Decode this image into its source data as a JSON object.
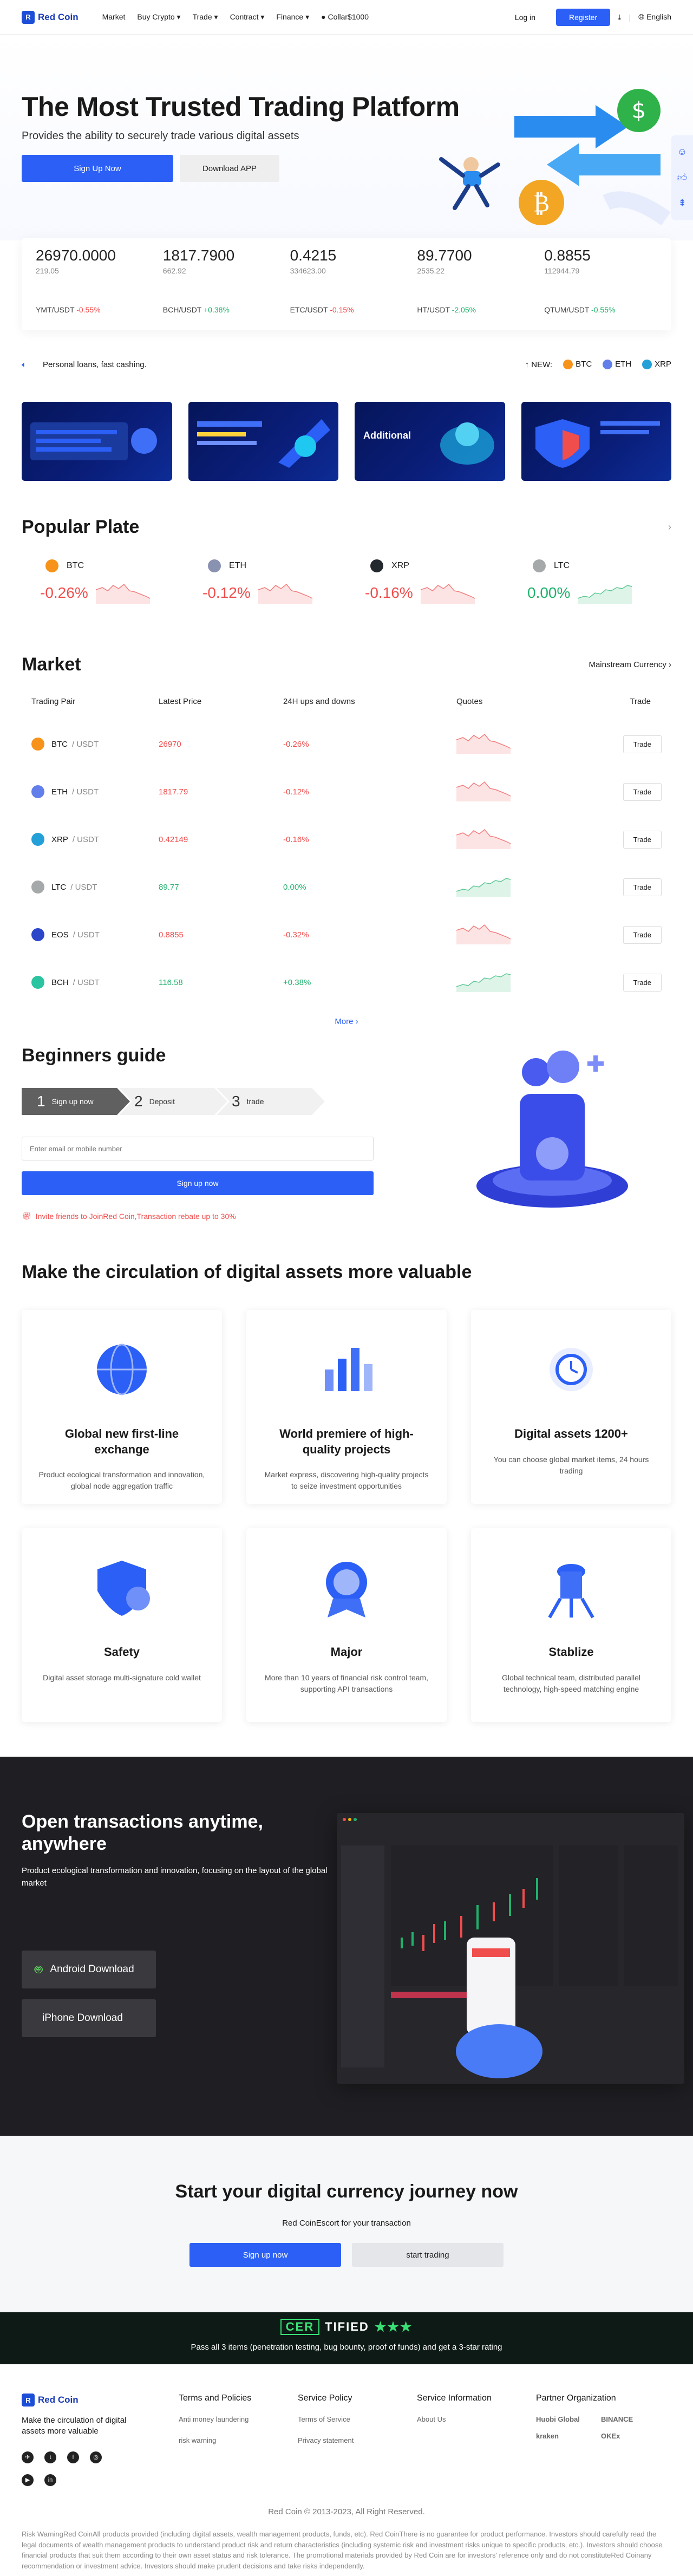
{
  "header": {
    "brand": "Red Coin",
    "nav": [
      "Market",
      "Buy Crypto ▾",
      "Trade ▾",
      "Contract ▾",
      "Finance ▾"
    ],
    "currency": "Collar$1000",
    "login": "Log in",
    "register": "Register",
    "language": "English"
  },
  "hero": {
    "title": "The Most Trusted Trading Platform",
    "subtitle": "Provides the ability to securely trade various digital assets",
    "signup": "Sign Up Now",
    "download": "Download APP"
  },
  "ticker": [
    {
      "price": "26970.0000",
      "vol": "219.05",
      "pair": "YMT/USDT",
      "chg": "-0.55%",
      "dir": "dn"
    },
    {
      "price": "1817.7900",
      "vol": "662.92",
      "pair": "BCH/USDT",
      "chg": "+0.38%",
      "dir": "up"
    },
    {
      "price": "0.4215",
      "vol": "334623.00",
      "pair": "ETC/USDT",
      "chg": "-0.15%",
      "dir": "dn"
    },
    {
      "price": "89.7700",
      "vol": "2535.22",
      "pair": "HT/USDT",
      "chg": "-2.05%",
      "dir": "up"
    },
    {
      "price": "0.8855",
      "vol": "112944.79",
      "pair": "QTUM/USDT",
      "chg": "-0.55%",
      "dir": "up"
    }
  ],
  "notice": {
    "message": "Personal loans, fast cashing.",
    "new_label": "NEW:",
    "coins": [
      "BTC",
      "ETH",
      "XRP"
    ]
  },
  "banners": [
    {
      "title": ""
    },
    {
      "title": ""
    },
    {
      "title": "Additional"
    },
    {
      "title": ""
    }
  ],
  "popular": {
    "title": "Popular Plate",
    "items": [
      {
        "name": "BTC",
        "chg": "-0.26%",
        "dir": "dn",
        "color": "#f7931a"
      },
      {
        "name": "ETH",
        "chg": "-0.12%",
        "dir": "dn",
        "color": "#8a92b2"
      },
      {
        "name": "XRP",
        "chg": "-0.16%",
        "dir": "dn",
        "color": "#23292f"
      },
      {
        "name": "LTC",
        "chg": "0.00%",
        "dir": "up",
        "color": "#a6a9aa"
      }
    ]
  },
  "market": {
    "title": "Market",
    "link": "Mainstream Currency",
    "headers": [
      "Trading Pair",
      "Latest Price",
      "24H ups and downs",
      "Quotes",
      "Trade"
    ],
    "rows": [
      {
        "base": "BTC",
        "quote": "/ USDT",
        "price": "26970",
        "chg": "-0.26%",
        "dir": "dn",
        "color": "#f7931a"
      },
      {
        "base": "ETH",
        "quote": "/ USDT",
        "price": "1817.79",
        "chg": "-0.12%",
        "dir": "dn",
        "color": "#627eea"
      },
      {
        "base": "XRP",
        "quote": "/ USDT",
        "price": "0.42149",
        "chg": "-0.16%",
        "dir": "dn",
        "color": "#23a0d8"
      },
      {
        "base": "LTC",
        "quote": "/ USDT",
        "price": "89.77",
        "chg": "0.00%",
        "dir": "up",
        "color": "#a6a9aa"
      },
      {
        "base": "EOS",
        "quote": "/ USDT",
        "price": "0.8855",
        "chg": "-0.32%",
        "dir": "dn",
        "color": "#2b46c8"
      },
      {
        "base": "BCH",
        "quote": "/ USDT",
        "price": "116.58",
        "chg": "+0.38%",
        "dir": "up",
        "color": "#2bc4a0"
      }
    ],
    "trade_label": "Trade",
    "more": "More"
  },
  "guide": {
    "title": "Beginners guide",
    "steps": [
      {
        "num": "1",
        "label": "Sign up now"
      },
      {
        "num": "2",
        "label": "Deposit"
      },
      {
        "num": "3",
        "label": "trade"
      }
    ],
    "placeholder": "Enter email or mobile number",
    "button": "Sign up now",
    "invite": "Invite friends to JoinRed Coin,Transaction rebate up to 30%"
  },
  "valuable": {
    "title": "Make the circulation of digital assets more valuable",
    "cards": [
      {
        "title": "Global new first-line exchange",
        "desc": "Product ecological transformation and innovation, global node aggregation traffic"
      },
      {
        "title": "World premiere of high-quality projects",
        "desc": "Market express, discovering high-quality projects to seize investment opportunities"
      },
      {
        "title": "Digital assets 1200+",
        "desc": "You can choose global market items, 24 hours trading"
      },
      {
        "title": "Safety",
        "desc": "Digital asset storage multi-signature cold wallet"
      },
      {
        "title": "Major",
        "desc": "More than 10 years of financial risk control team, supporting API transactions"
      },
      {
        "title": "Stablize",
        "desc": "Global technical team, distributed parallel technology, high-speed matching engine"
      }
    ]
  },
  "app": {
    "title": "Open transactions anytime, anywhere",
    "desc": "Product ecological transformation and innovation, focusing on the layout of the global market",
    "android": "Android Download",
    "iphone": "iPhone Download"
  },
  "journey": {
    "title": "Start your digital currency journey now",
    "sub": "Red CoinEscort for your transaction",
    "b1": "Sign up now",
    "b2": "start trading"
  },
  "certified": {
    "badge_a": "CER",
    "badge_b": "TIFIED",
    "stars": "★★★",
    "text": "Pass all 3 items (penetration testing, bug bounty, proof of funds) and get a 3-star rating"
  },
  "footer": {
    "tagline": "Make the circulation of digital assets more valuable",
    "cols": [
      {
        "title": "Terms and Policies",
        "items": [
          "Anti money laundering",
          "risk warning"
        ]
      },
      {
        "title": "Service Policy",
        "items": [
          "Terms of Service",
          "Privacy statement"
        ]
      },
      {
        "title": "Service Information",
        "items": [
          "About Us"
        ]
      }
    ],
    "partners_title": "Partner Organization",
    "partners": [
      "Huobi Global",
      "BINANCE",
      "kraken",
      "OKEx"
    ],
    "copyright": "Red Coin © 2013-2023, All Right Reserved.",
    "disclaimer": "Risk WarningRed CoinAll products provided (including digital assets, wealth management products, funds, etc). Red CoinThere is no guarantee for product performance. Investors should carefully read the legal documents of wealth management products to understand product risk and return characteristics (including systemic risk and investment risks unique to specific products, etc.). Investors should choose financial products that suit them according to their own asset status and risk tolerance. The promotional materials provided by Red Coin are for investors' reference only and do not constituteRed Coinany recommendation or investment advice. Investors should make prudent decisions and take risks independently."
  }
}
